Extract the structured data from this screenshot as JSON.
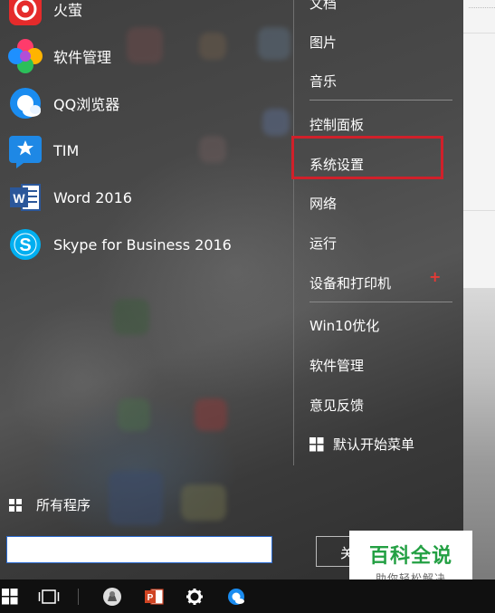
{
  "apps": [
    {
      "label": "火萤",
      "icon": "huoying-icon"
    },
    {
      "label": "软件管理",
      "icon": "software-manager-icon"
    },
    {
      "label": "QQ浏览器",
      "icon": "qq-browser-icon"
    },
    {
      "label": "TIM",
      "icon": "tim-icon"
    },
    {
      "label": "Word 2016",
      "icon": "word-icon"
    },
    {
      "label": "Skype for Business 2016",
      "icon": "skype-icon"
    }
  ],
  "right_menu": {
    "documents": "文档",
    "pictures": "图片",
    "music": "音乐",
    "control_panel": "控制面板",
    "system_settings": "系统设置",
    "network": "网络",
    "run": "运行",
    "devices_printers": "设备和打印机",
    "win10_optimize": "Win10优化",
    "software_manager": "软件管理",
    "feedback": "意见反馈",
    "default_start_menu": "默认开始菜单"
  },
  "all_programs": "所有程序",
  "search": {
    "value": ""
  },
  "power_label": "关",
  "watermark": {
    "title": "百科全说",
    "subtitle": "助你轻松解决"
  },
  "colors": {
    "highlight": "#d0202a",
    "watermark_green": "#23a043"
  }
}
